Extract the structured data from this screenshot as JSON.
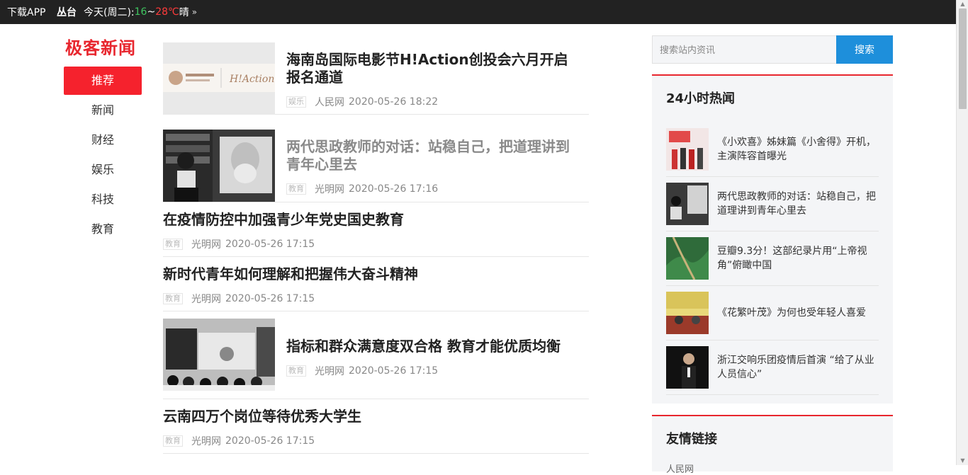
{
  "topbar": {
    "download": "下载APP",
    "city": "丛台",
    "today": "今天(周二):",
    "low": "16",
    "sep": "~",
    "high": "28℃",
    "weather": "晴",
    "more_icon": "double-chevron-right-icon"
  },
  "logo": "极客新闻",
  "nav": [
    {
      "label": "推荐",
      "active": true
    },
    {
      "label": "新闻"
    },
    {
      "label": "财经"
    },
    {
      "label": "娱乐"
    },
    {
      "label": "科技"
    },
    {
      "label": "教育"
    }
  ],
  "articles": [
    {
      "title": "海南岛国际电影节H!Action创投会六月开启报名通道",
      "tag": "娱乐",
      "source": "人民网",
      "time": "2020-05-26 18:22",
      "has_image": true
    },
    {
      "title": "两代思政教师的对话：站稳自己，把道理讲到青年心里去",
      "tag": "教育",
      "source": "光明网",
      "time": "2020-05-26 17:16",
      "has_image": true,
      "visited": true
    },
    {
      "title": "在疫情防控中加强青少年党史国史教育",
      "tag": "教育",
      "source": "光明网",
      "time": "2020-05-26 17:15"
    },
    {
      "title": "新时代青年如何理解和把握伟大奋斗精神",
      "tag": "教育",
      "source": "光明网",
      "time": "2020-05-26 17:15"
    },
    {
      "title": "指标和群众满意度双合格 教育才能优质均衡",
      "tag": "教育",
      "source": "光明网",
      "time": "2020-05-26 17:15",
      "has_image": true
    },
    {
      "title": "云南四万个岗位等待优秀大学生",
      "tag": "教育",
      "source": "光明网",
      "time": "2020-05-26 17:15"
    }
  ],
  "search": {
    "placeholder": "搜索站内资讯",
    "button": "搜索"
  },
  "hot": {
    "title": "24小时热闻",
    "items": [
      {
        "title": "《小欢喜》姊妹篇《小舍得》开机，主演阵容首曝光"
      },
      {
        "title": "两代思政教师的对话：站稳自己，把道理讲到青年心里去"
      },
      {
        "title": "豆瓣9.3分！这部纪录片用“上帝视角”俯瞰中国"
      },
      {
        "title": "《花繁叶茂》为何也受年轻人喜爱"
      },
      {
        "title": "浙江交响乐团疫情后首演 “给了从业人员信心”"
      }
    ]
  },
  "links": {
    "title": "友情链接",
    "first": "人民网"
  },
  "colors": {
    "accent": "#e8262e",
    "search_button": "#1e8fdb",
    "weather_low": "#3fc460",
    "weather_high": "#ff3b3b"
  }
}
